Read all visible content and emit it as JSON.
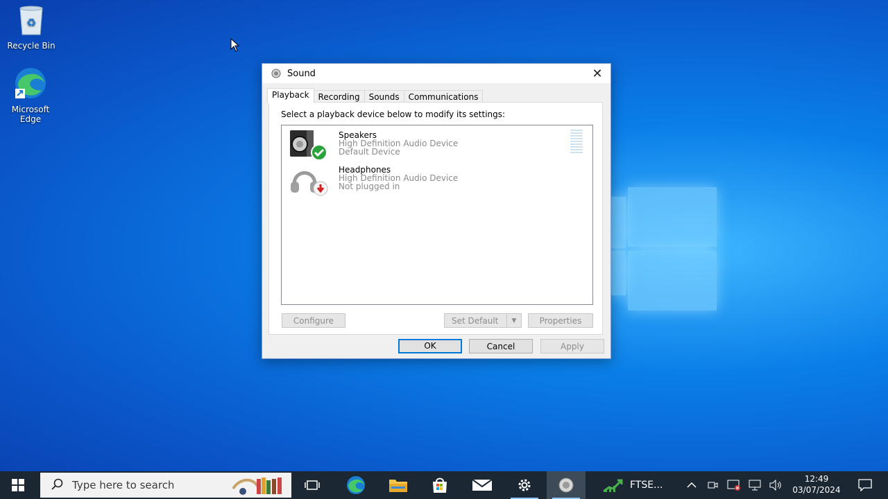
{
  "desktop": {
    "icons": [
      {
        "label": "Recycle Bin"
      },
      {
        "label": "Microsoft Edge"
      }
    ]
  },
  "dialog": {
    "title": "Sound",
    "tabs": [
      "Playback",
      "Recording",
      "Sounds",
      "Communications"
    ],
    "active_tab": "Playback",
    "instruction": "Select a playback device below to modify its settings:",
    "devices": [
      {
        "name": "Speakers",
        "driver": "High Definition Audio Device",
        "status": "Default Device",
        "icon": "speaker-icon",
        "badge": "green-check"
      },
      {
        "name": "Headphones",
        "driver": "High Definition Audio Device",
        "status": "Not plugged in",
        "icon": "headphones-icon",
        "badge": "red-down-arrow"
      }
    ],
    "buttons": {
      "configure": "Configure",
      "set_default": "Set Default",
      "properties": "Properties",
      "ok": "OK",
      "cancel": "Cancel",
      "apply": "Apply"
    }
  },
  "taskbar": {
    "search_placeholder": "Type here to search",
    "ftse_label": "FTSE...",
    "clock_time": "12:49",
    "clock_date": "03/07/2024",
    "pinned": [
      "task-view-icon",
      "edge-icon",
      "file-explorer-icon",
      "store-icon",
      "mail-icon",
      "settings-icon",
      "sound-icon"
    ]
  },
  "colors": {
    "accent": "#0078d7",
    "taskbar": "#1b2733",
    "desktop": "#0a7fe8"
  }
}
